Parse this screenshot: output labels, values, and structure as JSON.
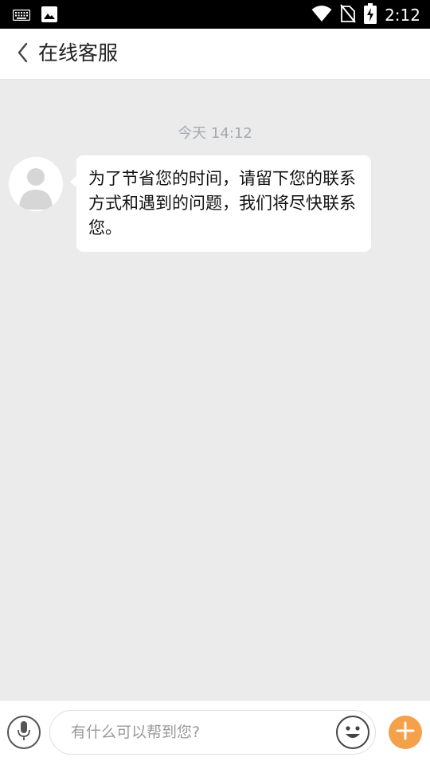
{
  "status_bar": {
    "time": "2:12",
    "left_icons": [
      "keyboard-icon",
      "image-icon"
    ],
    "right_icons": [
      "wifi-icon",
      "no-sim-icon",
      "battery-charging-icon"
    ],
    "background": "#000000"
  },
  "header": {
    "back_icon": "chevron-left-icon",
    "title": "在线客服"
  },
  "chat": {
    "background": "#ebebeb",
    "timestamp": "今天 14:12",
    "messages": [
      {
        "sender": "agent",
        "avatar_icon": "default-avatar-icon",
        "text": "为了节省您的时间，请留下您的联系方式和遇到的问题，我们将尽快联系您。"
      }
    ]
  },
  "input_bar": {
    "voice_icon": "microphone-icon",
    "placeholder": "有什么可以帮到您?",
    "value": "",
    "emoji_icon": "emoji-icon",
    "more_icon": "plus-icon",
    "accent_color": "#f5a04b"
  }
}
